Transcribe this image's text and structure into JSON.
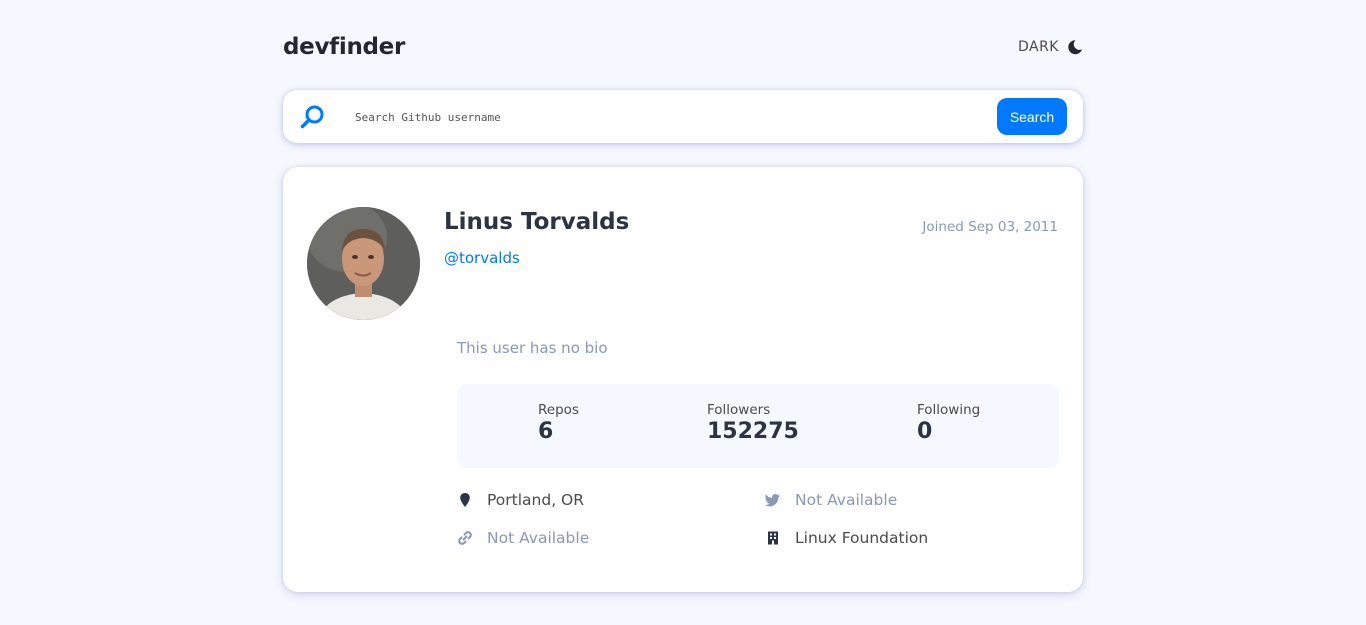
{
  "header": {
    "logo": "devfinder",
    "theme_toggle_label": "DARK"
  },
  "search": {
    "placeholder": "Search Github username",
    "button_label": "Search"
  },
  "profile": {
    "name": "Linus Torvalds",
    "login": "@torvalds",
    "joined": "Joined Sep 03, 2011",
    "bio": "This user has no bio"
  },
  "stats": {
    "repos_label": "Repos",
    "repos_value": "6",
    "followers_label": "Followers",
    "followers_value": "152275",
    "following_label": "Following",
    "following_value": "0"
  },
  "links": {
    "location": "Portland, OR",
    "website": "Not Available",
    "twitter": "Not Available",
    "company": "Linux Foundation"
  },
  "icons": {
    "theme": "moon-icon",
    "search": "search-icon",
    "location": "location-pin-icon",
    "website": "link-icon",
    "twitter": "twitter-icon",
    "company": "building-icon"
  },
  "colors": {
    "accent": "#0079ff",
    "background": "#f6f8ff",
    "muted": "#8a99b3",
    "text": "#2b3442"
  }
}
